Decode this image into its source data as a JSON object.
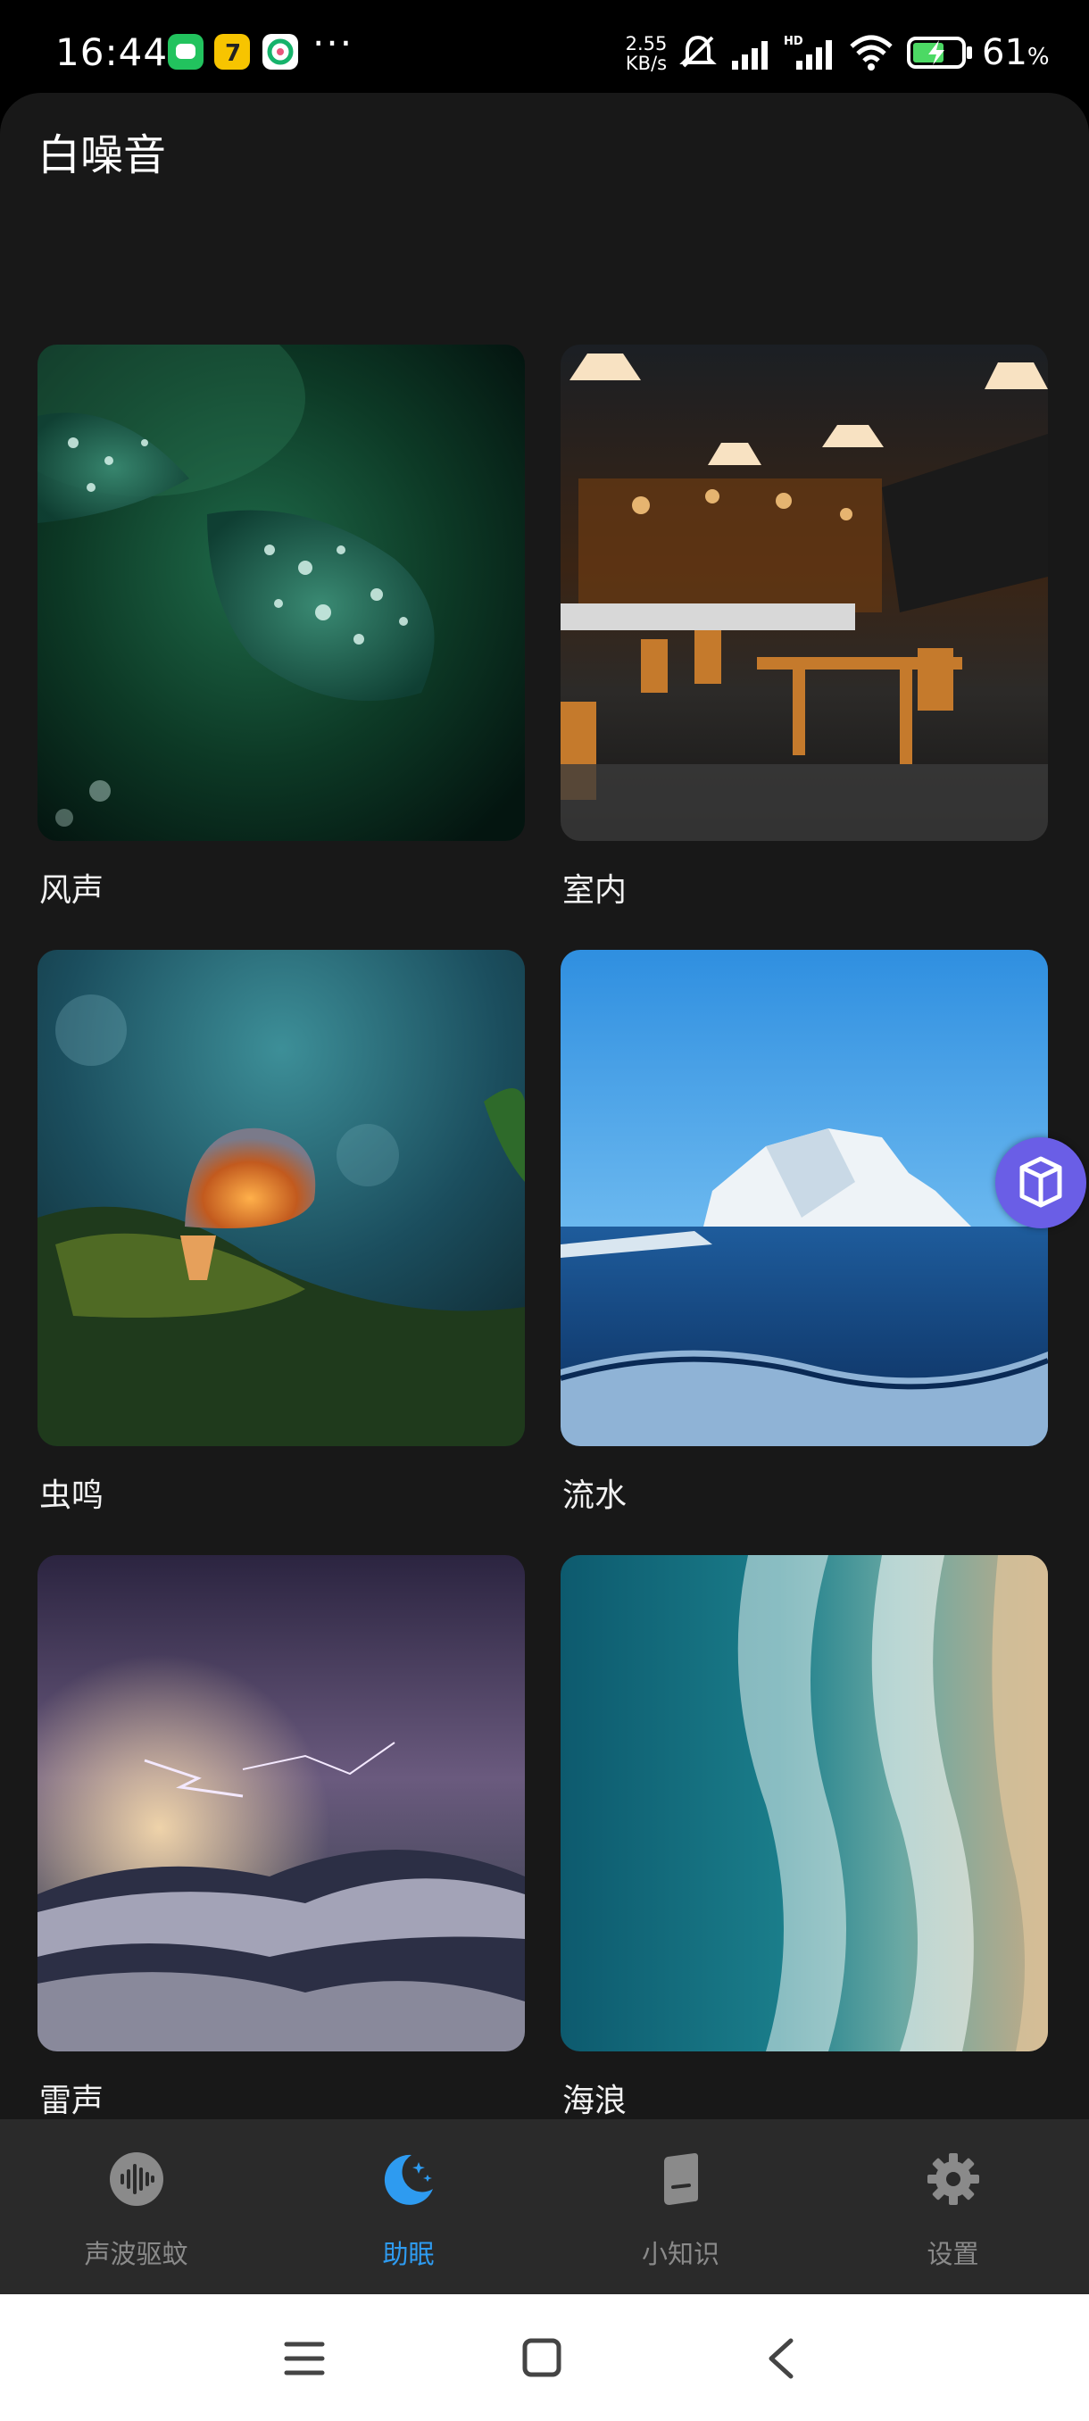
{
  "status_bar": {
    "time": "16:44",
    "network_speed_value": "2.55",
    "network_speed_unit": "KB/s",
    "battery_percent": "61",
    "battery_unit": "%",
    "more_indicator": "···"
  },
  "page": {
    "title": "白噪音"
  },
  "sounds": [
    {
      "label": "风声"
    },
    {
      "label": "室内"
    },
    {
      "label": "虫鸣"
    },
    {
      "label": "流水"
    },
    {
      "label": "雷声"
    },
    {
      "label": "海浪"
    }
  ],
  "tabbar": {
    "tabs": [
      {
        "label": "声波驱蚊",
        "icon": "soundwave-icon",
        "active": false
      },
      {
        "label": "助眠",
        "icon": "moon-stars-icon",
        "active": true
      },
      {
        "label": "小知识",
        "icon": "book-icon",
        "active": false
      },
      {
        "label": "设置",
        "icon": "gear-icon",
        "active": false
      }
    ],
    "active_color": "#2e9bf0",
    "inactive_color": "#8a8a8a"
  },
  "system_nav": {
    "buttons": [
      "menu-icon",
      "home-icon",
      "back-icon"
    ]
  }
}
